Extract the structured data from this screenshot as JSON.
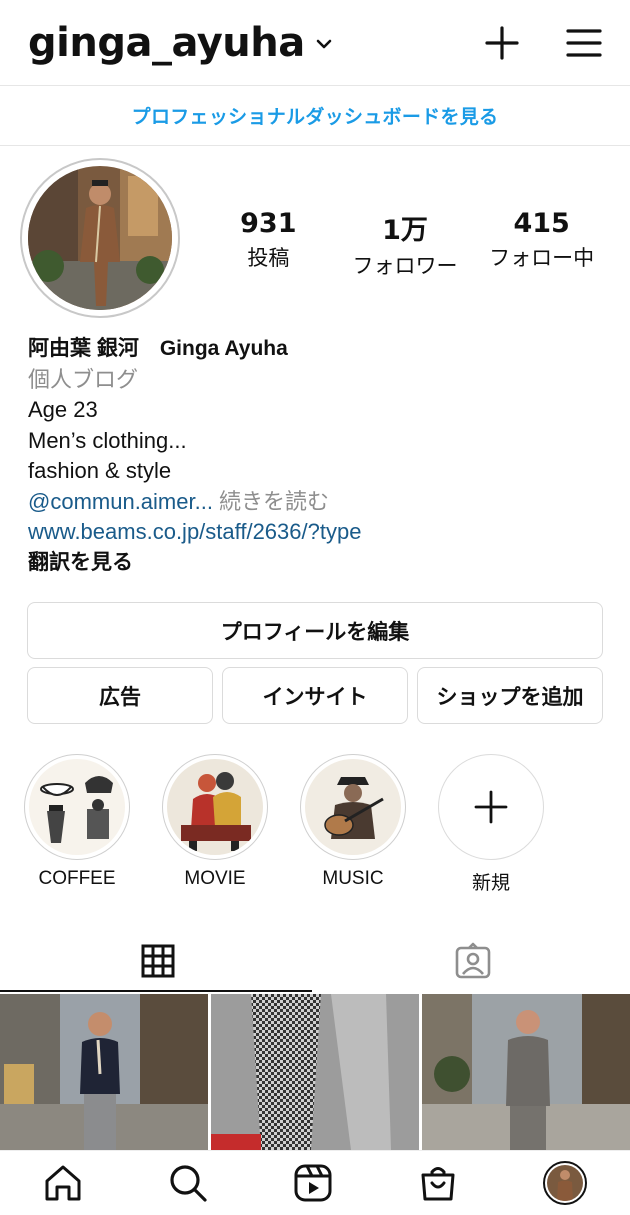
{
  "header": {
    "username": "ginga_ayuha",
    "icons": [
      "chevron-down-icon",
      "plus-icon",
      "hamburger-menu-icon"
    ]
  },
  "dashboard_link": "プロフェッショナルダッシュボードを見る",
  "stats": [
    {
      "value": "931",
      "label": "投稿"
    },
    {
      "value": "1万",
      "label": "フォロワー"
    },
    {
      "value": "415",
      "label": "フォロー中"
    }
  ],
  "bio": {
    "name": "阿由葉 銀河　Ginga Ayuha",
    "category": "個人ブログ",
    "line1": "Age 23",
    "line2": "Men’s clothing...",
    "line3": "fashion & style",
    "mention": "@commun.aimer...",
    "more": " 続きを読む",
    "url": "www.beams.co.jp/staff/2636/?type",
    "translate": "翻訳を見る"
  },
  "buttons": {
    "edit_profile": "プロフィールを編集",
    "ads": "広告",
    "insights": "インサイト",
    "add_shop": "ショップを追加"
  },
  "highlights": [
    {
      "label": "COFFEE"
    },
    {
      "label": "MOVIE"
    },
    {
      "label": "MUSIC"
    },
    {
      "label": "新規"
    }
  ],
  "tabs": [
    "grid-icon",
    "tagged-icon"
  ],
  "bottom_nav": [
    "home-icon",
    "search-icon",
    "reels-icon",
    "shop-icon",
    "profile-avatar"
  ],
  "colors": {
    "link_blue": "#1a9be6",
    "bio_link": "#1a5b8a",
    "border": "#dbdbdb"
  }
}
